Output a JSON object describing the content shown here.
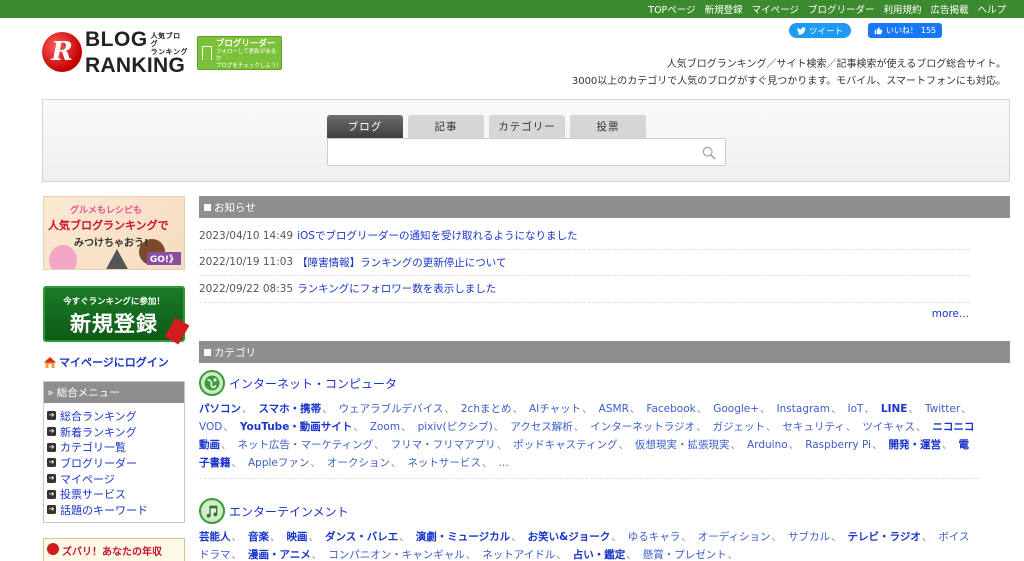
{
  "top_nav": [
    "TOPページ",
    "新規登録",
    "マイページ",
    "ブログリーダー",
    "利用規約",
    "広告掲載",
    "ヘルプ"
  ],
  "social": {
    "tweet_label": "ツイート",
    "like_label": "いいね！",
    "like_count": "155"
  },
  "logo": {
    "line1": "BLOG",
    "line2": "RANKING",
    "sub1": "人気ブログ",
    "sub2": "ランキング",
    "mark": "R"
  },
  "reader_badge": {
    "title": "ブログリーダー",
    "sub1": "フォローして更新があるか",
    "sub2": "ブログをチェックしよう!"
  },
  "tagline": {
    "line1": "人気ブログランキング／サイト検索／記事検索が使えるブログ総合サイト。",
    "line2": "3000以上のカテゴリで人気のブログがすぐ見つかります。モバイル、スマートフォンにも対応。"
  },
  "search": {
    "tabs": [
      "ブログ",
      "記事",
      "カテゴリー",
      "投票"
    ],
    "active_tab": 0,
    "value": "",
    "placeholder": ""
  },
  "sidebar": {
    "banner_gourmet": {
      "line1": "グルメもレシピも",
      "line2": "人気ブログランキングで",
      "line3": "みつけちゃおう!",
      "go": "GO!》"
    },
    "banner_signup": {
      "line1": "今すぐランキングに参加！",
      "line2": "新規登録"
    },
    "mypage_login": "マイページにログイン",
    "menu_title": "» 総合メニュー",
    "menu_items": [
      "総合ランキング",
      "新着ランキング",
      "カテゴリ一覧",
      "ブログリーダー",
      "マイページ",
      "投票サービス",
      "話題のキーワード"
    ],
    "zubari": "ズバリ！あなたの年収"
  },
  "news": {
    "title": "お知らせ",
    "items": [
      {
        "date": "2023/04/10 14:49",
        "text": "iOSでブログリーダーの通知を受け取れるようになりました"
      },
      {
        "date": "2022/10/19 11:03",
        "text": "【障害情報】ランキングの更新停止について"
      },
      {
        "date": "2022/09/22 08:35",
        "text": "ランキングにフォロワー数を表示しました"
      }
    ],
    "more": "more..."
  },
  "categories": {
    "title": "カテゴリ",
    "groups": [
      {
        "name": "インターネット・コンピュータ",
        "icon": "globe-icon",
        "items": [
          {
            "t": "パソコン",
            "b": true
          },
          {
            "t": "スマホ・携帯",
            "b": true
          },
          {
            "t": "ウェアラブルデバイス"
          },
          {
            "t": "2chまとめ"
          },
          {
            "t": "AIチャット"
          },
          {
            "t": "ASMR"
          },
          {
            "t": "Facebook"
          },
          {
            "t": "Google+"
          },
          {
            "t": "Instagram"
          },
          {
            "t": "IoT"
          },
          {
            "t": "LINE",
            "b": true
          },
          {
            "t": "Twitter"
          },
          {
            "t": "VOD"
          },
          {
            "t": "YouTube・動画サイト",
            "b": true
          },
          {
            "t": "Zoom"
          },
          {
            "t": "pixiv(ピクシブ)"
          },
          {
            "t": "アクセス解析"
          },
          {
            "t": "インターネットラジオ"
          },
          {
            "t": "ガジェット"
          },
          {
            "t": "セキュリティ"
          },
          {
            "t": "ツイキャス"
          },
          {
            "t": "ニコニコ動画",
            "b": true
          },
          {
            "t": "ネット広告・マーケティング"
          },
          {
            "t": "フリマ・フリマアプリ"
          },
          {
            "t": "ポッドキャスティング"
          },
          {
            "t": "仮想現実・拡張現実"
          },
          {
            "t": "Arduino"
          },
          {
            "t": "Raspberry Pi"
          },
          {
            "t": "開発・運営",
            "b": true
          },
          {
            "t": "電子書籍",
            "b": true
          },
          {
            "t": "Appleファン"
          },
          {
            "t": "オークション"
          },
          {
            "t": "ネットサービス"
          }
        ],
        "ellipsis": "…"
      },
      {
        "name": "エンターテインメント",
        "icon": "music-note-icon",
        "items": [
          {
            "t": "芸能人",
            "b": true
          },
          {
            "t": "音楽",
            "b": true
          },
          {
            "t": "映画",
            "b": true
          },
          {
            "t": "ダンス・バレエ",
            "b": true
          },
          {
            "t": "演劇・ミュージカル",
            "b": true
          },
          {
            "t": "お笑い&ジョーク",
            "b": true
          },
          {
            "t": "ゆるキャラ"
          },
          {
            "t": "オーディション"
          },
          {
            "t": "サブカル"
          },
          {
            "t": "テレビ・ラジオ",
            "b": true
          },
          {
            "t": "ボイスドラマ"
          },
          {
            "t": "漫画・アニメ",
            "b": true
          },
          {
            "t": "コンパニオン・キャンギャル"
          },
          {
            "t": "ネットアイドル"
          },
          {
            "t": "占い・鑑定",
            "b": true
          },
          {
            "t": "懸賞・プレゼント"
          }
        ],
        "ellipsis": ""
      }
    ]
  }
}
